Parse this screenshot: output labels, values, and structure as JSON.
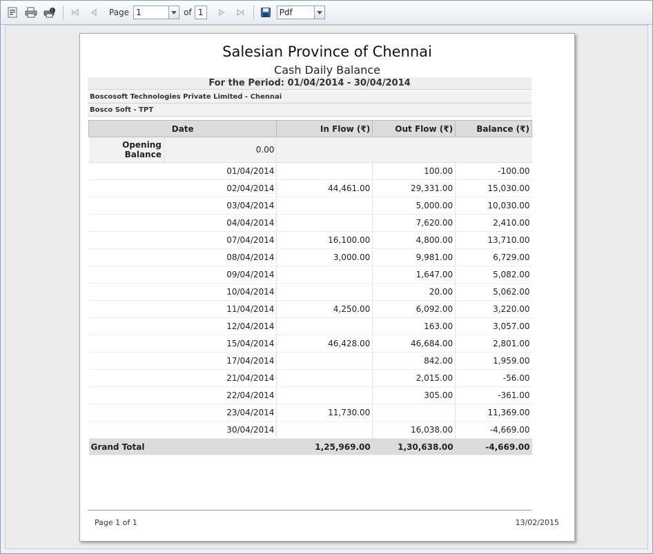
{
  "toolbar": {
    "page_label": "Page",
    "page_value": "1",
    "of_label": "of",
    "total_pages": "1",
    "export_format": "Pdf"
  },
  "report": {
    "title": "Salesian Province of Chennai",
    "subtitle": "Cash Daily Balance",
    "period": "For the Period: 01/04/2014 - 30/04/2014",
    "org1": "Boscosoft Technologies Private Limited - Chennai",
    "org2": "Bosco Soft - TPT",
    "columns": {
      "date": "Date",
      "inflow": "In Flow (₹)",
      "outflow": "Out Flow (₹)",
      "balance": "Balance (₹)"
    },
    "opening_label": "Opening Balance",
    "opening_value": "0.00",
    "rows": [
      {
        "date": "01/04/2014",
        "inflow": "",
        "outflow": "100.00",
        "balance": "-100.00"
      },
      {
        "date": "02/04/2014",
        "inflow": "44,461.00",
        "outflow": "29,331.00",
        "balance": "15,030.00"
      },
      {
        "date": "03/04/2014",
        "inflow": "",
        "outflow": "5,000.00",
        "balance": "10,030.00"
      },
      {
        "date": "04/04/2014",
        "inflow": "",
        "outflow": "7,620.00",
        "balance": "2,410.00"
      },
      {
        "date": "07/04/2014",
        "inflow": "16,100.00",
        "outflow": "4,800.00",
        "balance": "13,710.00"
      },
      {
        "date": "08/04/2014",
        "inflow": "3,000.00",
        "outflow": "9,981.00",
        "balance": "6,729.00"
      },
      {
        "date": "09/04/2014",
        "inflow": "",
        "outflow": "1,647.00",
        "balance": "5,082.00"
      },
      {
        "date": "10/04/2014",
        "inflow": "",
        "outflow": "20.00",
        "balance": "5,062.00"
      },
      {
        "date": "11/04/2014",
        "inflow": "4,250.00",
        "outflow": "6,092.00",
        "balance": "3,220.00"
      },
      {
        "date": "12/04/2014",
        "inflow": "",
        "outflow": "163.00",
        "balance": "3,057.00"
      },
      {
        "date": "15/04/2014",
        "inflow": "46,428.00",
        "outflow": "46,684.00",
        "balance": "2,801.00"
      },
      {
        "date": "17/04/2014",
        "inflow": "",
        "outflow": "842.00",
        "balance": "1,959.00"
      },
      {
        "date": "21/04/2014",
        "inflow": "",
        "outflow": "2,015.00",
        "balance": "-56.00"
      },
      {
        "date": "22/04/2014",
        "inflow": "",
        "outflow": "305.00",
        "balance": "-361.00"
      },
      {
        "date": "23/04/2014",
        "inflow": "11,730.00",
        "outflow": "",
        "balance": "11,369.00"
      },
      {
        "date": "30/04/2014",
        "inflow": "",
        "outflow": "16,038.00",
        "balance": "-4,669.00"
      }
    ],
    "grand_total": {
      "label": "Grand Total",
      "inflow": "1,25,969.00",
      "outflow": "1,30,638.00",
      "balance": "-4,669.00"
    },
    "footer_page": "Page 1 of 1",
    "footer_date": "13/02/2015"
  }
}
